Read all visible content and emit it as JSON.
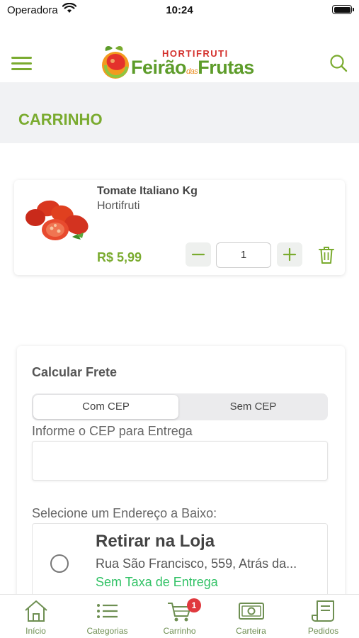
{
  "status_bar": {
    "carrier": "Operadora",
    "time": "10:24"
  },
  "header": {
    "logo_top": "HORTIFRUTI",
    "logo_part1": "Feirão",
    "logo_part2": "das",
    "logo_part3": "Frutas"
  },
  "page": {
    "title": "CARRINHO"
  },
  "cart": {
    "items": [
      {
        "name": "Tomate Italiano Kg",
        "category": "Hortifruti",
        "price": "R$ 5,99",
        "quantity": "1"
      }
    ]
  },
  "shipping": {
    "title": "Calcular Frete",
    "segments": [
      "Com CEP",
      "Sem CEP"
    ],
    "selected_segment": "Com CEP",
    "cep_label": "Informe o CEP para Entrega",
    "cep_value": "",
    "address_label": "Selecione um Endereço a Baixo:",
    "options": [
      {
        "title": "Retirar na Loja",
        "address": "Rua São Francisco, 559, Atrás da...",
        "fee": "Sem Taxa de Entrega"
      }
    ]
  },
  "tab_bar": {
    "tabs": [
      {
        "label": "Início",
        "icon": "home-icon"
      },
      {
        "label": "Categorias",
        "icon": "list-icon"
      },
      {
        "label": "Carrinho",
        "icon": "cart-icon",
        "badge": "1"
      },
      {
        "label": "Carteira",
        "icon": "money-icon"
      },
      {
        "label": "Pedidos",
        "icon": "receipt-icon"
      }
    ]
  },
  "colors": {
    "brand_green": "#7aab2f",
    "fee_green": "#32c266",
    "badge_red": "#e0393e",
    "background_band": "#f1f2f4"
  }
}
